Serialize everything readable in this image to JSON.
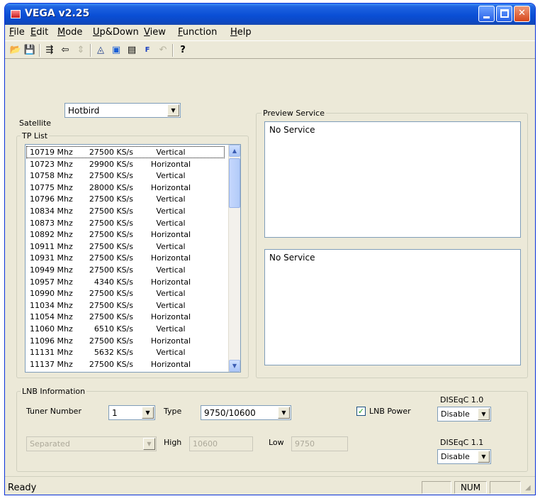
{
  "window": {
    "title": "VEGA v2.25"
  },
  "menu": [
    "File",
    "Edit",
    "Mode",
    "Up&Down",
    "View",
    "Function",
    "Help"
  ],
  "toolbar_icons": [
    "open-folder-icon",
    "save-disk-icon",
    "import-icon",
    "export-icon",
    "sort-icon",
    "antenna-icon",
    "monitor-icon",
    "tv-icon",
    "fav-icon",
    "undo-icon",
    "help-icon"
  ],
  "satellite": {
    "label": "Satellite",
    "value": "Hotbird"
  },
  "tp_list": {
    "label": "TP List",
    "rows": [
      {
        "freq": "10719 Mhz",
        "sr": "27500 KS/s",
        "pol": "Vertical"
      },
      {
        "freq": "10723 Mhz",
        "sr": "29900 KS/s",
        "pol": "Horizontal"
      },
      {
        "freq": "10758 Mhz",
        "sr": "27500 KS/s",
        "pol": "Vertical"
      },
      {
        "freq": "10775 Mhz",
        "sr": "28000 KS/s",
        "pol": "Horizontal"
      },
      {
        "freq": "10796 Mhz",
        "sr": "27500 KS/s",
        "pol": "Vertical"
      },
      {
        "freq": "10834 Mhz",
        "sr": "27500 KS/s",
        "pol": "Vertical"
      },
      {
        "freq": "10873 Mhz",
        "sr": "27500 KS/s",
        "pol": "Vertical"
      },
      {
        "freq": "10892 Mhz",
        "sr": "27500 KS/s",
        "pol": "Horizontal"
      },
      {
        "freq": "10911 Mhz",
        "sr": "27500 KS/s",
        "pol": "Vertical"
      },
      {
        "freq": "10931 Mhz",
        "sr": "27500 KS/s",
        "pol": "Horizontal"
      },
      {
        "freq": "10949 Mhz",
        "sr": "27500 KS/s",
        "pol": "Vertical"
      },
      {
        "freq": "10957 Mhz",
        "sr": "4340 KS/s",
        "pol": "Horizontal"
      },
      {
        "freq": "10990 Mhz",
        "sr": "27500 KS/s",
        "pol": "Vertical"
      },
      {
        "freq": "11034 Mhz",
        "sr": "27500 KS/s",
        "pol": "Vertical"
      },
      {
        "freq": "11054 Mhz",
        "sr": "27500 KS/s",
        "pol": "Horizontal"
      },
      {
        "freq": "11060 Mhz",
        "sr": "6510 KS/s",
        "pol": "Vertical"
      },
      {
        "freq": "11096 Mhz",
        "sr": "27500 KS/s",
        "pol": "Horizontal"
      },
      {
        "freq": "11131 Mhz",
        "sr": "5632 KS/s",
        "pol": "Vertical"
      },
      {
        "freq": "11137 Mhz",
        "sr": "27500 KS/s",
        "pol": "Horizontal"
      }
    ]
  },
  "preview": {
    "label": "Preview Service",
    "top_text": "No Service",
    "bottom_text": "No Service"
  },
  "lnb": {
    "label": "LNB Information",
    "tuner_label": "Tuner Number",
    "tuner_value": "1",
    "type_label": "Type",
    "type_value": "9750/10600",
    "power_label": "LNB Power",
    "power_checked": true,
    "mode_value": "Separated",
    "high_label": "High",
    "high_value": "10600",
    "low_label": "Low",
    "low_value": "9750",
    "diseqc10_label": "DISEqC 1.0",
    "diseqc10_value": "Disable",
    "diseqc11_label": "DISEqC 1.1",
    "diseqc11_value": "Disable"
  },
  "status": {
    "text": "Ready",
    "num": "NUM"
  }
}
